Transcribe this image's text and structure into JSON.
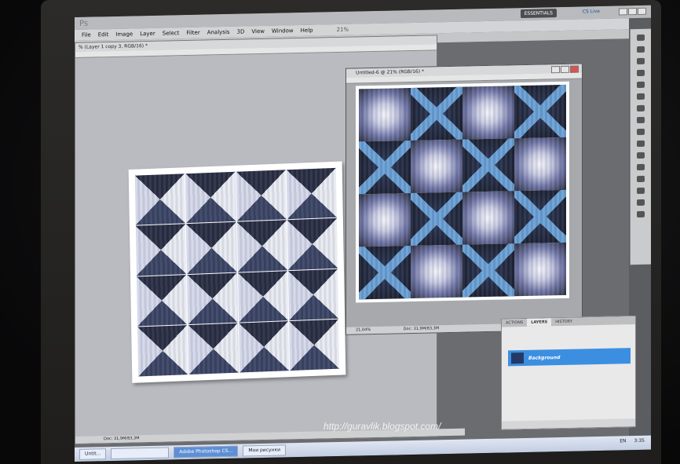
{
  "watermark": "http://guravlik.blogspot.com/",
  "app": {
    "logo": "Ps",
    "essentials": "ESSENTIALS",
    "cslive": "CS Live"
  },
  "menu": [
    "File",
    "Edit",
    "Image",
    "Layer",
    "Select",
    "Filter",
    "Analysis",
    "3D",
    "View",
    "Window",
    "Help"
  ],
  "toolbar": {
    "zoom": "21%"
  },
  "doc1": {
    "title": "% (Layer 1 copy 3, RGB/16) *",
    "status": "Doc: 31,9M/83,3M"
  },
  "doc2": {
    "title": "Untitled-6 @ 21% (RGB/16) *",
    "zoom": "21,04%",
    "status": "Doc: 31,9M/83,3M"
  },
  "layers": {
    "tabs": [
      "ACTIONS",
      "LAYERS",
      "HISTORY"
    ],
    "active_tab": "LAYERS",
    "layer_name": "Background"
  },
  "taskbar": {
    "items": [
      "Untit...",
      "",
      "Adobe Photoshop CS...",
      "Мои рисунки"
    ],
    "lang": "EN",
    "clock": "3:35"
  }
}
